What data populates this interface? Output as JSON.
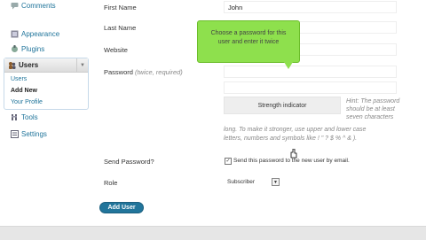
{
  "sidebar": {
    "items": [
      {
        "label": "Comments",
        "icon": "comments-icon"
      },
      {
        "label": "Appearance",
        "icon": "appearance-icon"
      },
      {
        "label": "Plugins",
        "icon": "plugins-icon"
      },
      {
        "label": "Tools",
        "icon": "tools-icon"
      },
      {
        "label": "Settings",
        "icon": "settings-icon"
      }
    ],
    "users": {
      "label": "Users",
      "submenu": [
        "Users",
        "Add New",
        "Your Profile"
      ]
    }
  },
  "form": {
    "first_name": {
      "label": "First Name",
      "value": "John"
    },
    "last_name": {
      "label": "Last Name",
      "value": ""
    },
    "website": {
      "label": "Website",
      "value": ""
    },
    "password": {
      "label": "Password",
      "hint": "(twice, required)"
    },
    "strength_indicator": "Strength indicator",
    "password_hint_1": "Hint: The password",
    "password_hint_2": "should be at least",
    "password_hint_3": "seven characters",
    "password_hint_4": "long. To make it stronger, use upper and lower case",
    "password_hint_5": "letters, numbers and symbols like ! \" ? $ % ^ & ).",
    "send_password": {
      "label": "Send Password?",
      "checkbox_label": "Send this password to the new user by email.",
      "checked": true
    },
    "role": {
      "label": "Role",
      "value": "Subscriber"
    },
    "submit_label": "Add User"
  },
  "callout": {
    "line1": "Choose a password for this",
    "line2": "user and enter it twice"
  },
  "colors": {
    "accent": "#21759b",
    "callout": "#8ee04d",
    "footer": "#e6e6e6"
  }
}
